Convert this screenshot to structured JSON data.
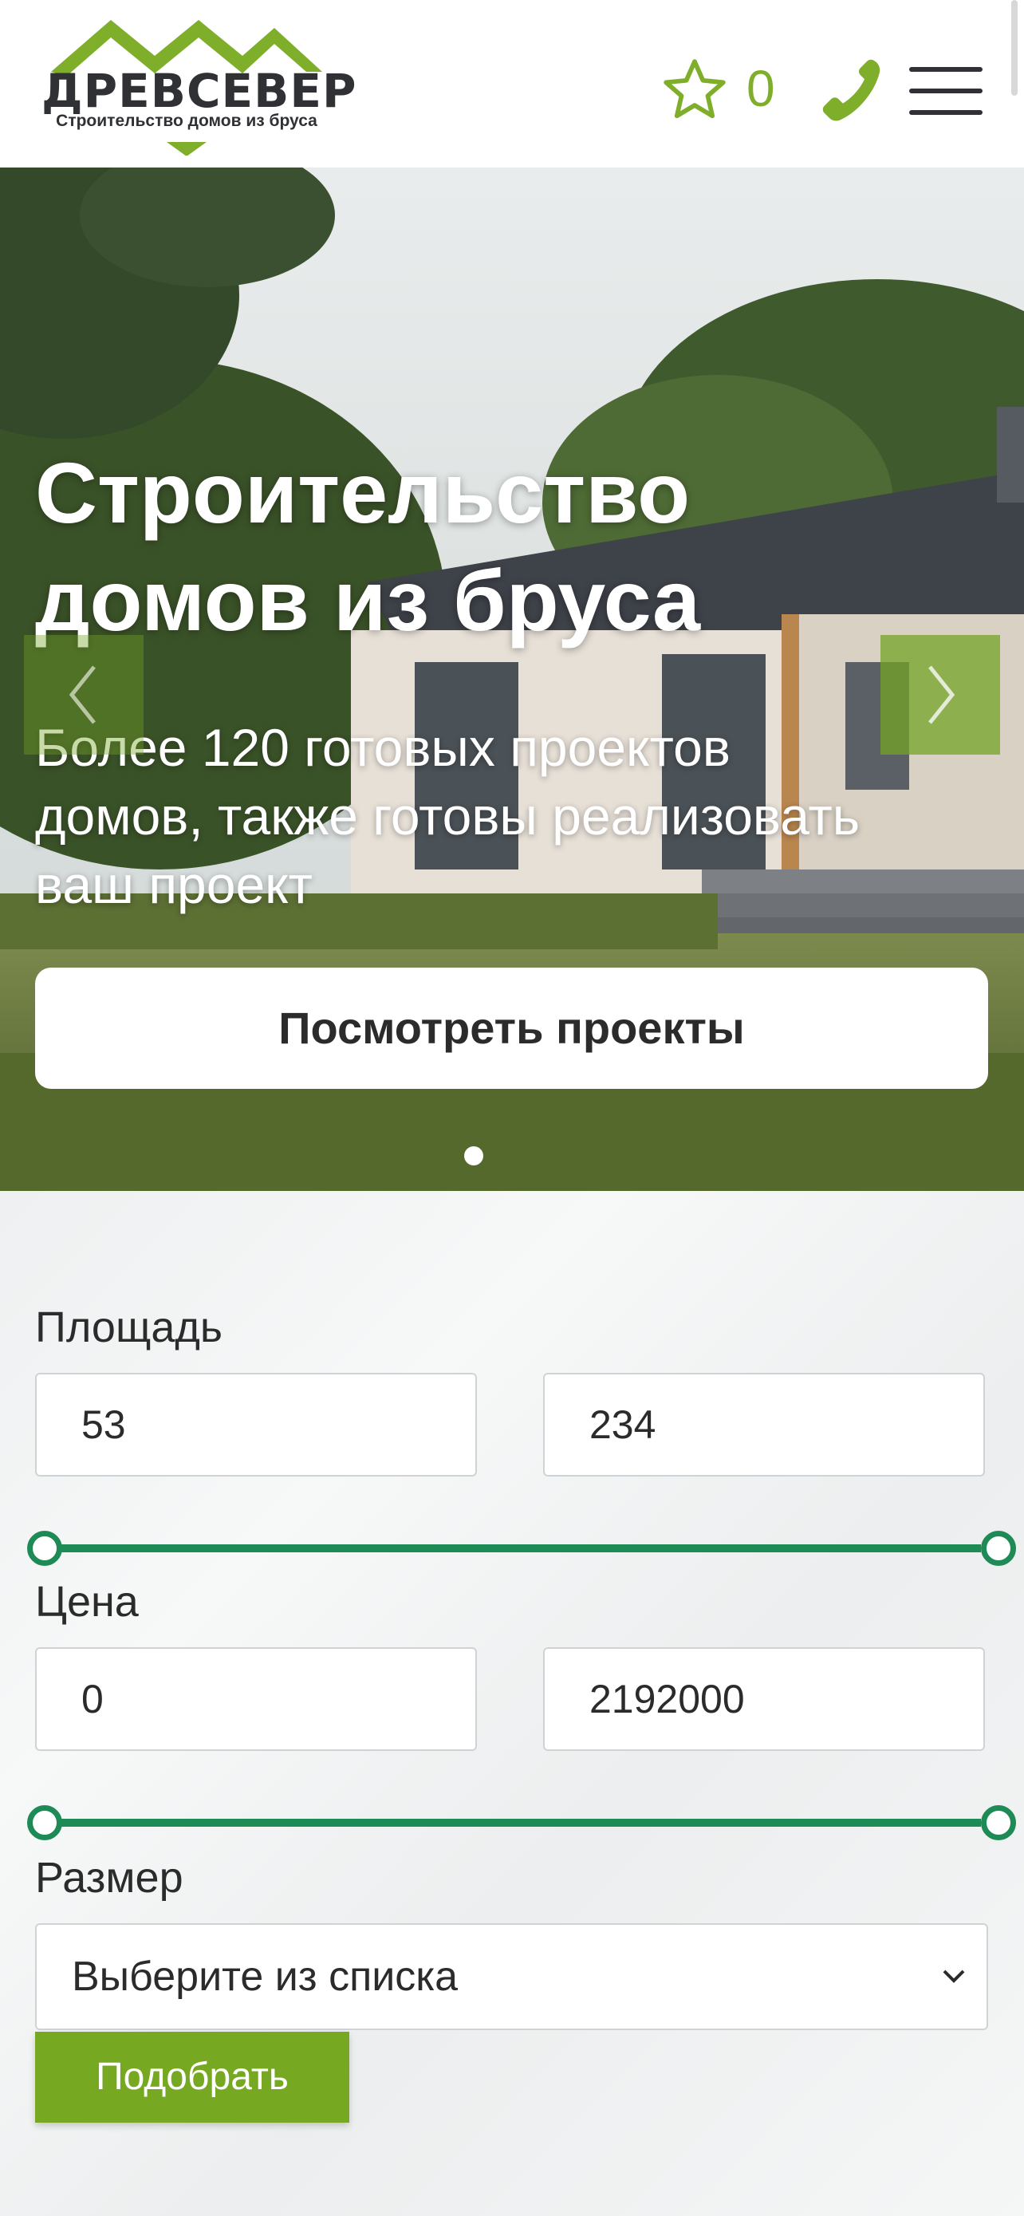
{
  "header": {
    "logo_text": "ДРЕВСЕВЕР",
    "logo_tagline": "Строительство домов из бруса",
    "favorites_count": "0",
    "icons": [
      "star-icon",
      "phone-icon",
      "hamburger-menu-icon"
    ],
    "accent_color": "#7fae2b"
  },
  "hero": {
    "title_line1": "Строительство",
    "title_line2": "домов из бруса",
    "subtitle_line1": "Более 120 готовых проектов",
    "subtitle_line2": "домов, также готовы реализовать",
    "subtitle_line3": "ваш проект",
    "button_label": "Посмотреть проекты",
    "slide_count": 1,
    "active_slide": 1
  },
  "filter": {
    "area": {
      "label": "Площадь",
      "min_value": "53",
      "max_value": "234"
    },
    "price": {
      "label": "Цена",
      "min_value": "0",
      "max_value": "2192000"
    },
    "size": {
      "label": "Размер",
      "selected": "Выберите из списка"
    },
    "submit_label": "Подобрать",
    "slider_color": "#1e8a55"
  }
}
